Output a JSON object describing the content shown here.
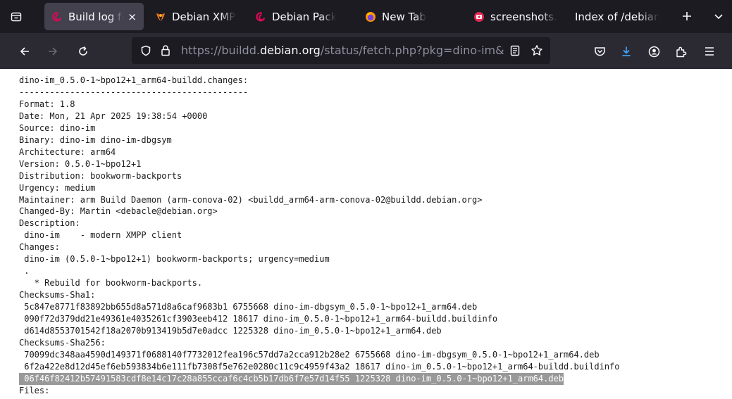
{
  "tabs": [
    {
      "label": "Build log fo",
      "close": "×",
      "icon": "debian-swirl-icon",
      "active": true
    },
    {
      "label": "Debian XMPP",
      "icon": "xmpp-icon",
      "active": false
    },
    {
      "label": "Debian Packa",
      "icon": "debian-swirl-icon",
      "active": false
    },
    {
      "label": "New Tab",
      "icon": "firefox-icon",
      "active": false
    },
    {
      "label": "screenshots.",
      "icon": "screenshots-icon",
      "active": false
    },
    {
      "label": "Index of /debian",
      "icon": "",
      "active": false
    }
  ],
  "nav": {
    "url_prefix": "https://buildd.",
    "url_host": "debian.org",
    "url_suffix": "/status/fetch.php?pkg=dino-im&"
  },
  "log_lines": [
    "dino-im_0.5.0-1~bpo12+1_arm64-buildd.changes:",
    "---------------------------------------------",
    "",
    "Format: 1.8",
    "Date: Mon, 21 Apr 2025 19:38:54 +0000",
    "Source: dino-im",
    "Binary: dino-im dino-im-dbgsym",
    "Architecture: arm64",
    "Version: 0.5.0-1~bpo12+1",
    "Distribution: bookworm-backports",
    "Urgency: medium",
    "Maintainer: arm Build Daemon (arm-conova-02) <buildd_arm64-arm-conova-02@buildd.debian.org>",
    "Changed-By: Martin <debacle@debian.org>",
    "Description:",
    " dino-im    - modern XMPP client",
    "Changes:",
    " dino-im (0.5.0-1~bpo12+1) bookworm-backports; urgency=medium",
    " .",
    "   * Rebuild for bookworm-backports.",
    "Checksums-Sha1:",
    " 5c847e8771f83892bb655d8a571d8a6caf9683b1 6755668 dino-im-dbgsym_0.5.0-1~bpo12+1_arm64.deb",
    " 090f72d379dd21e49361e4035261cf3903eeb412 18617 dino-im_0.5.0-1~bpo12+1_arm64-buildd.buildinfo",
    " d614d8553701542f18a2070b913419b5d7e0adcc 1225328 dino-im_0.5.0-1~bpo12+1_arm64.deb",
    "Checksums-Sha256:",
    " 70099dc348aa4590d149371f0688140f7732012fea196c57dd7a2cca912b28e2 6755668 dino-im-dbgsym_0.5.0-1~bpo12+1_arm64.deb",
    " 6f2a422e8d12d45ef6eb593834b6e111fb7308f5e762e0280c11c9c4959f43a2 18617 dino-im_0.5.0-1~bpo12+1_arm64-buildd.buildinfo",
    " 06f46f82412b57491583cdf8e14c17c28a855ccaf6c4cb5b17db6f7e57d14f55 1225328 dino-im_0.5.0-1~bpo12+1_arm64.deb",
    "Files:"
  ]
}
